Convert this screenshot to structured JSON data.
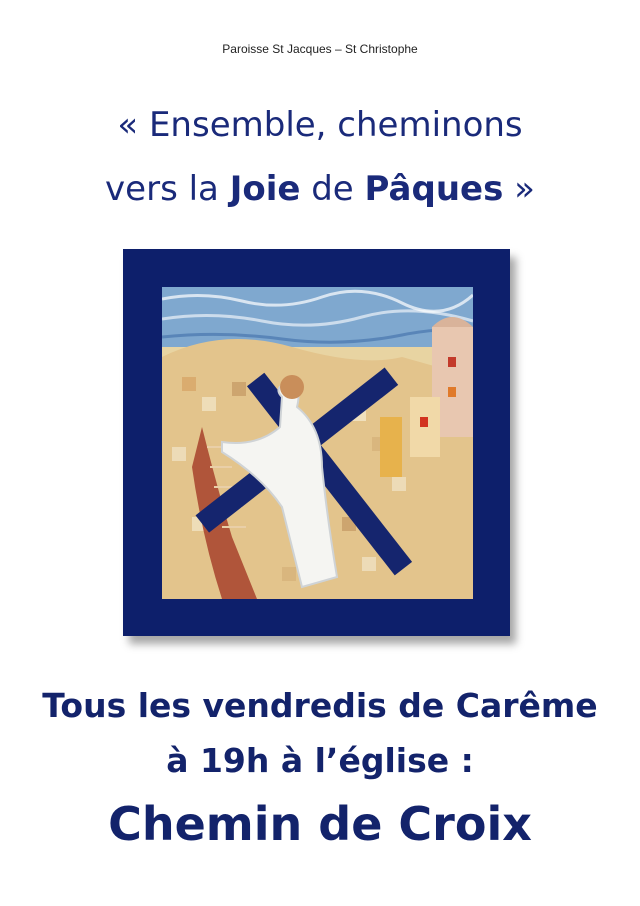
{
  "header": {
    "parish": "Paroisse St Jacques – St Christophe"
  },
  "title": {
    "line1": "« Ensemble, cheminons",
    "line2_prefix": "vers la ",
    "line2_bold1": "Joie",
    "line2_mid": " de ",
    "line2_bold2": "Pâques",
    "line2_suffix": " »"
  },
  "image": {
    "description_icon": "mosaic-cross-icon"
  },
  "announcement": {
    "line1": "Tous  les vendredis de Carême",
    "line2": "à 19h à l’église  :",
    "line3": "Chemin de Croix"
  },
  "colors": {
    "navy": "#0d1f6b",
    "text_blue": "#13236b"
  }
}
